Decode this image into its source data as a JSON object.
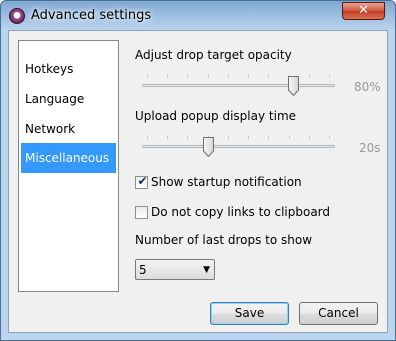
{
  "window": {
    "title": "Advanced settings",
    "close_label": "✕"
  },
  "sidebar": {
    "items": [
      {
        "label": "Hotkeys"
      },
      {
        "label": "Language"
      },
      {
        "label": "Network"
      },
      {
        "label": "Miscellaneous"
      }
    ],
    "selected": "Miscellaneous"
  },
  "settings": {
    "opacity": {
      "label": "Adjust drop target opacity",
      "value_text": "80%",
      "fraction": 0.8
    },
    "popup_time": {
      "label": "Upload popup display time",
      "value_text": "20s",
      "fraction": 0.333
    },
    "show_startup": {
      "label": "Show startup notification",
      "checked": true,
      "mark": "✔"
    },
    "no_copy": {
      "label": "Do not copy links to clipboard",
      "checked": false
    },
    "last_drops": {
      "label": "Number of last drops to show",
      "value": "5",
      "arrow": "▼"
    }
  },
  "buttons": {
    "save": "Save",
    "cancel": "Cancel"
  },
  "colors": {
    "accent": "#3399ff",
    "close": "#c03a1f"
  }
}
